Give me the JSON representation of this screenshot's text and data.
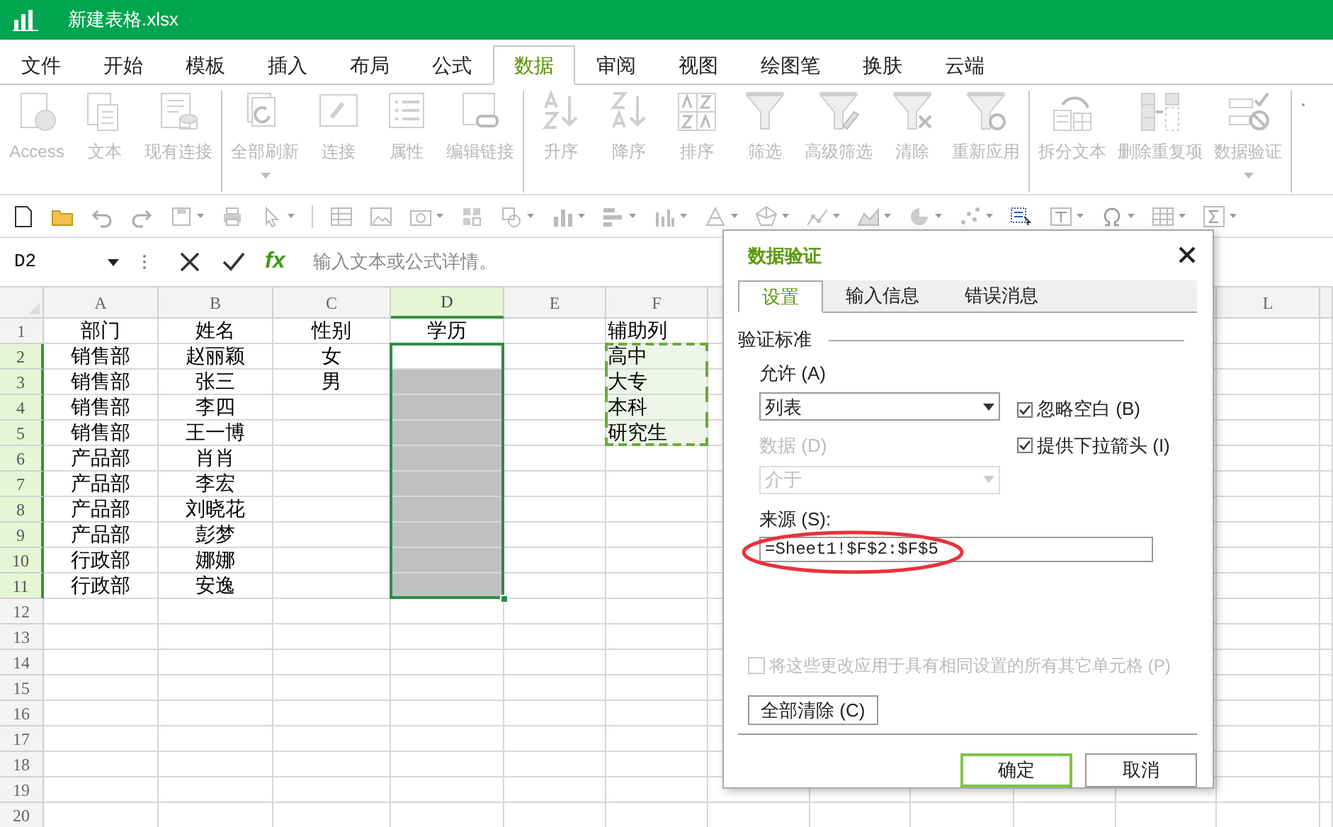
{
  "window": {
    "title": "新建表格.xlsx"
  },
  "menu_tabs": [
    {
      "label": "文件",
      "selected": false
    },
    {
      "label": "开始",
      "selected": false
    },
    {
      "label": "模板",
      "selected": false
    },
    {
      "label": "插入",
      "selected": false
    },
    {
      "label": "布局",
      "selected": false
    },
    {
      "label": "公式",
      "selected": false
    },
    {
      "label": "数据",
      "selected": true
    },
    {
      "label": "审阅",
      "selected": false
    },
    {
      "label": "视图",
      "selected": false
    },
    {
      "label": "绘图笔",
      "selected": false
    },
    {
      "label": "换肤",
      "selected": false
    },
    {
      "label": "云端",
      "selected": false
    }
  ],
  "ribbon": {
    "groups": [
      {
        "buttons": [
          {
            "label": "Access",
            "disabled": true,
            "dropdown": false
          },
          {
            "label": "文本",
            "disabled": true,
            "dropdown": false
          },
          {
            "label": "现有连接",
            "disabled": true,
            "dropdown": false
          }
        ]
      },
      {
        "buttons": [
          {
            "label": "全部刷新",
            "disabled": true,
            "dropdown": true
          },
          {
            "label": "连接",
            "disabled": true,
            "dropdown": false
          },
          {
            "label": "属性",
            "disabled": true,
            "dropdown": false
          },
          {
            "label": "编辑链接",
            "disabled": true,
            "dropdown": false
          }
        ]
      },
      {
        "buttons": [
          {
            "label": "升序",
            "disabled": true,
            "dropdown": false
          },
          {
            "label": "降序",
            "disabled": true,
            "dropdown": false
          },
          {
            "label": "排序",
            "disabled": true,
            "dropdown": false
          },
          {
            "label": "筛选",
            "disabled": true,
            "dropdown": false
          },
          {
            "label": "高级筛选",
            "disabled": true,
            "dropdown": false
          },
          {
            "label": "清除",
            "disabled": true,
            "dropdown": false
          },
          {
            "label": "重新应用",
            "disabled": true,
            "dropdown": false
          }
        ]
      },
      {
        "buttons": [
          {
            "label": "拆分文本",
            "disabled": true,
            "dropdown": false
          },
          {
            "label": "删除重复项",
            "disabled": true,
            "dropdown": false
          },
          {
            "label": "数据验证",
            "disabled": true,
            "dropdown": true
          }
        ]
      }
    ]
  },
  "formula_bar": {
    "cell_ref": "D2",
    "fx": "fx",
    "placeholder": "输入文本或公式详情。"
  },
  "sheet": {
    "columns": [
      {
        "label": "A",
        "selected": false
      },
      {
        "label": "B",
        "selected": false
      },
      {
        "label": "C",
        "selected": false
      },
      {
        "label": "D",
        "selected": true
      },
      {
        "label": "E",
        "selected": false
      },
      {
        "label": "F",
        "selected": false
      },
      {
        "label": "L",
        "selected": false
      }
    ],
    "rows": [
      {
        "number": "1",
        "selected": false,
        "shaded": false,
        "marked": false,
        "cells": {
          "A": "部门",
          "B": "姓名",
          "C": "性别",
          "D": "学历",
          "F": "辅助列"
        }
      },
      {
        "number": "2",
        "selected": true,
        "shaded": false,
        "marked": true,
        "cells": {
          "A": "销售部",
          "B": "赵丽颖",
          "C": "女",
          "F": "高中"
        }
      },
      {
        "number": "3",
        "selected": true,
        "shaded": true,
        "marked": true,
        "cells": {
          "A": "销售部",
          "B": "张三",
          "C": "男",
          "F": "大专"
        }
      },
      {
        "number": "4",
        "selected": true,
        "shaded": true,
        "marked": true,
        "cells": {
          "A": "销售部",
          "B": "李四",
          "F": "本科"
        }
      },
      {
        "number": "5",
        "selected": true,
        "shaded": true,
        "marked": true,
        "cells": {
          "A": "销售部",
          "B": "王一博",
          "F": "研究生"
        }
      },
      {
        "number": "6",
        "selected": true,
        "shaded": true,
        "marked": false,
        "cells": {
          "A": "产品部",
          "B": "肖肖"
        }
      },
      {
        "number": "7",
        "selected": true,
        "shaded": true,
        "marked": false,
        "cells": {
          "A": "产品部",
          "B": "李宏"
        }
      },
      {
        "number": "8",
        "selected": true,
        "shaded": true,
        "marked": false,
        "cells": {
          "A": "产品部",
          "B": "刘晓花"
        }
      },
      {
        "number": "9",
        "selected": true,
        "shaded": true,
        "marked": false,
        "cells": {
          "A": "产品部",
          "B": "彭梦"
        }
      },
      {
        "number": "10",
        "selected": true,
        "shaded": true,
        "marked": false,
        "cells": {
          "A": "行政部",
          "B": "娜娜"
        }
      },
      {
        "number": "11",
        "selected": true,
        "shaded": true,
        "marked": false,
        "cells": {
          "A": "行政部",
          "B": "安逸"
        }
      },
      {
        "number": "12",
        "selected": false,
        "shaded": false,
        "marked": false
      },
      {
        "number": "13",
        "selected": false,
        "shaded": false,
        "marked": false
      },
      {
        "number": "14",
        "selected": false,
        "shaded": false,
        "marked": false
      },
      {
        "number": "15",
        "selected": false,
        "shaded": false,
        "marked": false
      },
      {
        "number": "16",
        "selected": false,
        "shaded": false,
        "marked": false
      },
      {
        "number": "17",
        "selected": false,
        "shaded": false,
        "marked": false
      },
      {
        "number": "18",
        "selected": false,
        "shaded": false,
        "marked": false
      },
      {
        "number": "19",
        "selected": false,
        "shaded": false,
        "marked": false
      },
      {
        "number": "20",
        "selected": false,
        "shaded": false,
        "marked": false
      }
    ]
  },
  "dialog": {
    "title": "数据验证",
    "tabs": [
      {
        "label": "设置",
        "selected": true
      },
      {
        "label": "输入信息",
        "selected": false
      },
      {
        "label": "错误消息",
        "selected": false
      }
    ],
    "section": "验证标准",
    "allow_label": "允许 (A)",
    "allow_value": "列表",
    "options": [
      {
        "label": "忽略空白 (B)",
        "checked": true
      },
      {
        "label": "提供下拉箭头 (I)",
        "checked": true
      }
    ],
    "data_label": "数据 (D)",
    "data_value": "介于",
    "data_disabled": true,
    "source_label": "来源 (S):",
    "source_value": "=Sheet1!$F$2:$F$5",
    "apply_all": {
      "label": "将这些更改应用于具有相同设置的所有其它单元格 (P)",
      "checked": false,
      "disabled": true
    },
    "clear_button": "全部清除 (C)",
    "buttons": [
      {
        "label": "确定",
        "kind": "primary"
      },
      {
        "label": "取消",
        "kind": "secondary"
      }
    ]
  }
}
